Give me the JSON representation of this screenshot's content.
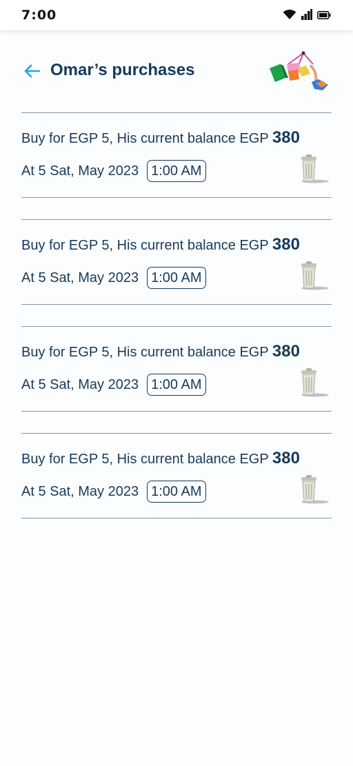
{
  "status_bar": {
    "time": "7:00",
    "icons": [
      "wifi-icon",
      "cellular-signal-icon",
      "battery-icon"
    ]
  },
  "header": {
    "title": "Omar’s purchases",
    "back_icon": "arrow-left-icon",
    "illustration": "shopping-bags-illustration"
  },
  "purchases": [
    {
      "description": "Buy for EGP 5, His current balance EGP",
      "balance": "380",
      "date": "At 5 Sat, May 2023",
      "time": "1:00 AM",
      "delete_icon": "trash-can-icon"
    },
    {
      "description": "Buy for EGP 5, His current balance EGP",
      "balance": "380",
      "date": "At 5 Sat, May 2023",
      "time": "1:00 AM",
      "delete_icon": "trash-can-icon"
    },
    {
      "description": "Buy for EGP 5, His current balance EGP",
      "balance": "380",
      "date": "At 5 Sat, May 2023",
      "time": "1:00 AM",
      "delete_icon": "trash-can-icon"
    },
    {
      "description": "Buy for EGP 5, His current balance EGP",
      "balance": "380",
      "date": "At 5 Sat, May 2023",
      "time": "1:00 AM",
      "delete_icon": "trash-can-icon"
    }
  ],
  "colors": {
    "primary_text": "#163a5a",
    "accent": "#29a3e0",
    "divider": "#8096a8",
    "background": "#fcfdfe"
  }
}
